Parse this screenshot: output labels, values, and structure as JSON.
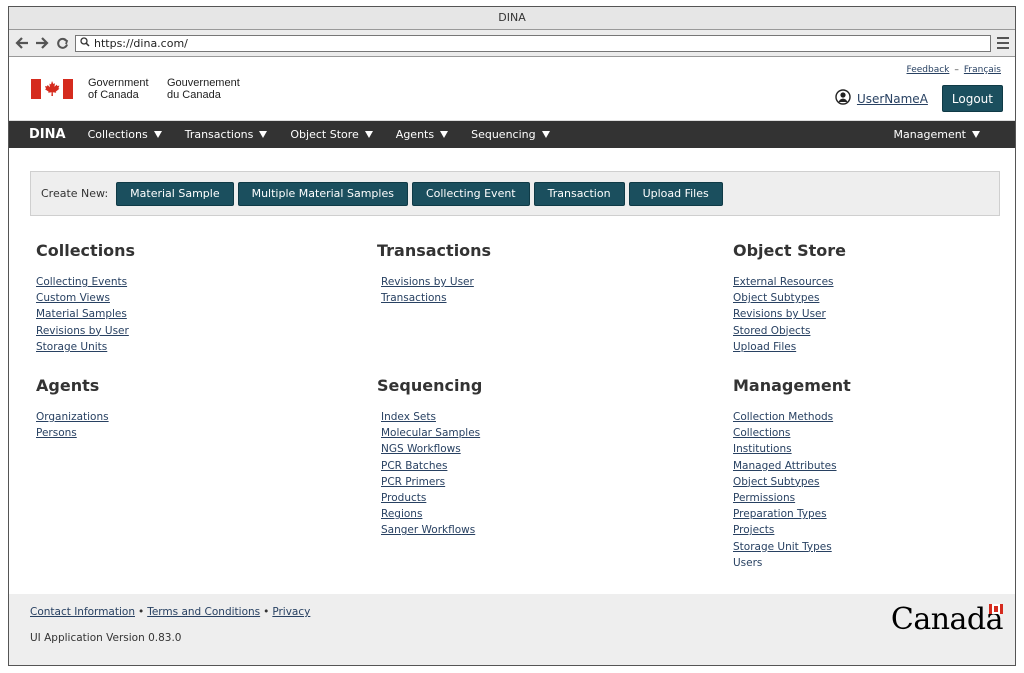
{
  "window": {
    "title": "DINA"
  },
  "browser": {
    "url": "https://dina.com/",
    "back_icon": "arrow-left-icon",
    "forward_icon": "arrow-right-icon",
    "reload_icon": "reload-icon",
    "menu_icon": "hamburger-menu-icon"
  },
  "gov_header": {
    "en": "Government\nof Canada",
    "fr": "Gouvernement\ndu Canada",
    "feedback": "Feedback",
    "separator": "–",
    "francais": "Français",
    "username": "UserNameA",
    "logout": "Logout"
  },
  "nav": {
    "brand": "DINA",
    "items": [
      "Collections",
      "Transactions",
      "Object Store",
      "Agents",
      "Sequencing"
    ],
    "right": "Management"
  },
  "create_new": {
    "label": "Create New:",
    "buttons": [
      "Material Sample",
      "Multiple Material Samples",
      "Collecting Event",
      "Transaction",
      "Upload Files"
    ]
  },
  "sections": {
    "collections": {
      "title": "Collections",
      "links": [
        "Collecting Events",
        "Custom Views",
        "Material Samples",
        "Revisions by User",
        "Storage Units"
      ]
    },
    "transactions": {
      "title": "Transactions",
      "links": [
        "Revisions by User",
        "Transactions"
      ]
    },
    "object_store": {
      "title": "Object Store",
      "links": [
        "External Resources",
        "Object Subtypes",
        "Revisions by User",
        "Stored Objects",
        "Upload Files"
      ]
    },
    "agents": {
      "title": "Agents",
      "links": [
        "Organizations",
        "Persons"
      ]
    },
    "sequencing": {
      "title": "Sequencing",
      "links": [
        "Index Sets",
        "Molecular Samples",
        "NGS Workflows",
        "PCR Batches",
        "PCR Primers",
        "Products",
        "Regions",
        "Sanger Workflows"
      ]
    },
    "management": {
      "title": "Management",
      "links": [
        "Collection Methods",
        "Collections",
        "Institutions",
        "Managed Attributes",
        "Object Subtypes",
        "Permissions",
        "Preparation Types",
        "Projects",
        "Storage Unit Types",
        "Users"
      ]
    }
  },
  "footer": {
    "contact": "Contact Information",
    "terms": "Terms and Conditions",
    "privacy": "Privacy",
    "bullet": "•",
    "version": "UI Application Version 0.83.0",
    "wordmark": "Canada"
  },
  "colors": {
    "primary_button": "#1b4f5e",
    "nav_bg": "#333333",
    "link": "#284162",
    "flag_red": "#d52b1e"
  }
}
